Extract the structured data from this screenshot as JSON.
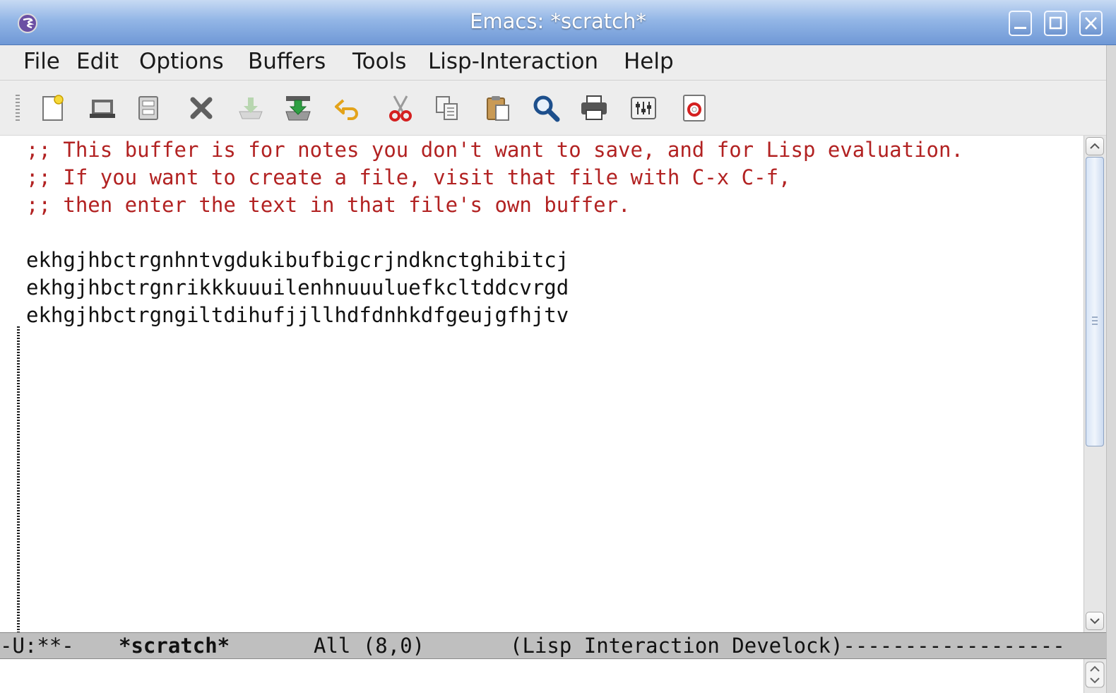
{
  "window": {
    "title": "Emacs: *scratch*",
    "controls": [
      "minimize-icon",
      "maximize-icon",
      "close-icon"
    ]
  },
  "menubar": {
    "items": [
      "File",
      "Edit",
      "Options",
      "Buffers",
      "Tools",
      "Lisp-Interaction",
      "Help"
    ]
  },
  "toolbar": {
    "icons": [
      "new-file-icon",
      "open-folder-icon",
      "save-icon",
      "close-buffer-icon",
      "save-as-icon",
      "save-download-icon",
      "undo-icon",
      "cut-icon",
      "copy-icon",
      "paste-icon",
      "search-icon",
      "print-icon",
      "preferences-icon",
      "help-icon"
    ]
  },
  "editor": {
    "lines": [
      {
        "text": ";; This buffer is for notes you don't want to save, and for Lisp evaluation.",
        "type": "comment"
      },
      {
        "text": ";; If you want to create a file, visit that file with C-x C-f,",
        "type": "comment"
      },
      {
        "text": ";; then enter the text in that file's own buffer.",
        "type": "comment"
      },
      {
        "text": "",
        "type": "plain"
      },
      {
        "text": "ekhgjhbctrgnhntvgdukibufbigcrjndknctghibitcj",
        "type": "plain"
      },
      {
        "text": "ekhgjhbctrgnrikkkuuuilenhnuuuluefkcltddcvrgd",
        "type": "plain"
      },
      {
        "text": "ekhgjhbctrgngiltdihufjjllhdfdnhkdfgeujgfhjtv",
        "type": "plain"
      }
    ]
  },
  "modeline": {
    "status": "-U:**-",
    "buffer": "*scratch*",
    "position": "All (8,0)",
    "mode": "(Lisp Interaction Develock)------------------"
  },
  "colors": {
    "comment": "#b22222",
    "titlebar": "#7ea3dc",
    "modeline": "#bfbfbf"
  }
}
